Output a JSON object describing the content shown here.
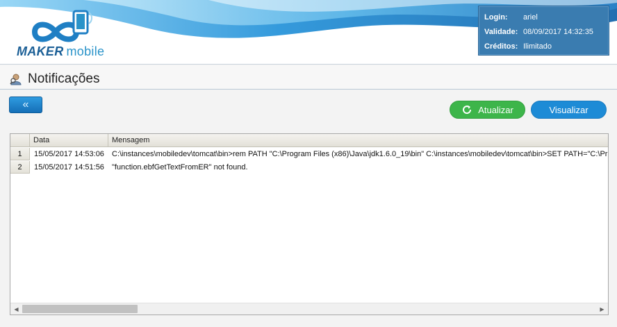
{
  "brand": {
    "name_bold": "MAKER",
    "name_light": "mobile"
  },
  "session": {
    "login_label": "Login:",
    "login_value": "ariel",
    "validity_label": "Validade:",
    "validity_value": "08/09/2017 14:32:35",
    "credits_label": "Créditos:",
    "credits_value": "Ilimitado"
  },
  "page": {
    "title": "Notificações",
    "icon": "search-person-icon"
  },
  "toolbar": {
    "back_glyph": "«",
    "refresh_label": "Atualizar",
    "view_label": "Visualizar"
  },
  "grid": {
    "columns": [
      "Data",
      "Mensagem"
    ],
    "rows": [
      {
        "num": "1",
        "date": "15/05/2017 14:53:06",
        "message": "C:\\instances\\mobiledev\\tomcat\\bin>rem PATH \"C:\\Program Files (x86)\\Java\\jdk1.6.0_19\\bin\" C:\\instances\\mobiledev\\tomcat\\bin>SET PATH=\"C:\\Pro"
      },
      {
        "num": "2",
        "date": "15/05/2017 14:51:56",
        "message": "\"function.ebfGetTextFromER\" not found."
      }
    ]
  },
  "colors": {
    "info_box": "#3a7cb0",
    "refresh_button": "#3db54a",
    "view_button": "#1d8bd6",
    "back_button": "#1f86cf"
  }
}
